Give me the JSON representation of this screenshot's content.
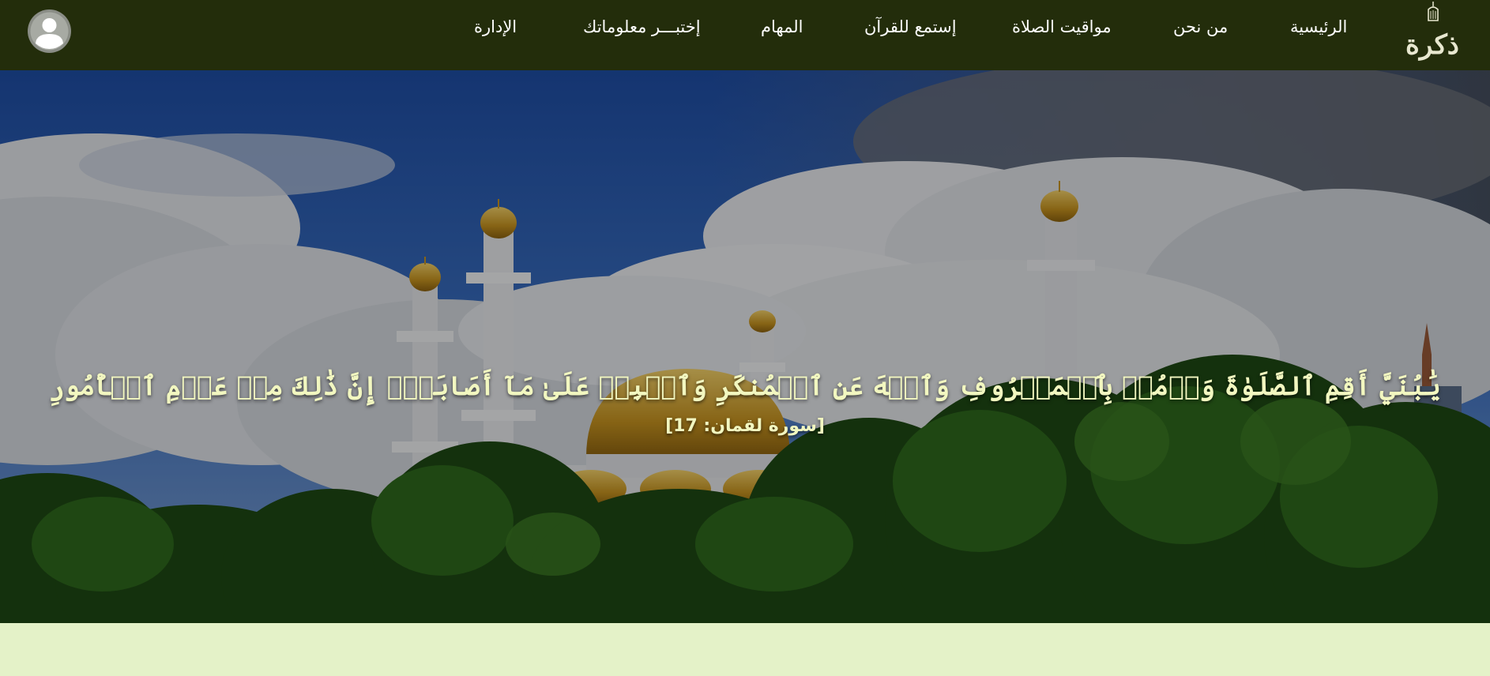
{
  "header": {
    "nav": {
      "home": "الرئيسية",
      "about": "من نحن",
      "prayer_times": "مواقيت الصلاة",
      "listen_quran": "إستمع للقرآن",
      "tasks": "المهام",
      "quiz": "إختبـــر معلوماتك",
      "admin": "الإدارة"
    },
    "logo_text": "ذكرة",
    "avatar_icon": "user-avatar-icon"
  },
  "hero": {
    "verse": "يَٰبُنَيَّ أَقِمِ ٱلصَّلَوٰةَ وَأۡمُرۡ بِٱلۡمَعۡرُوفِ وَٱنۡهَ عَنِ ٱلۡمُنكَرِ وَٱصۡبِرۡ عَلَىٰ مَآ أَصَابَكَۖ إِنَّ ذَٰلِكَ مِنۡ عَزۡمِ ٱلۡأُمُورِ",
    "reference": "[سورة لقمان: 17]"
  },
  "colors": {
    "navbar": "#232d0b",
    "page_background": "#e4f2c8",
    "verse_text": "#f2f7c0"
  }
}
